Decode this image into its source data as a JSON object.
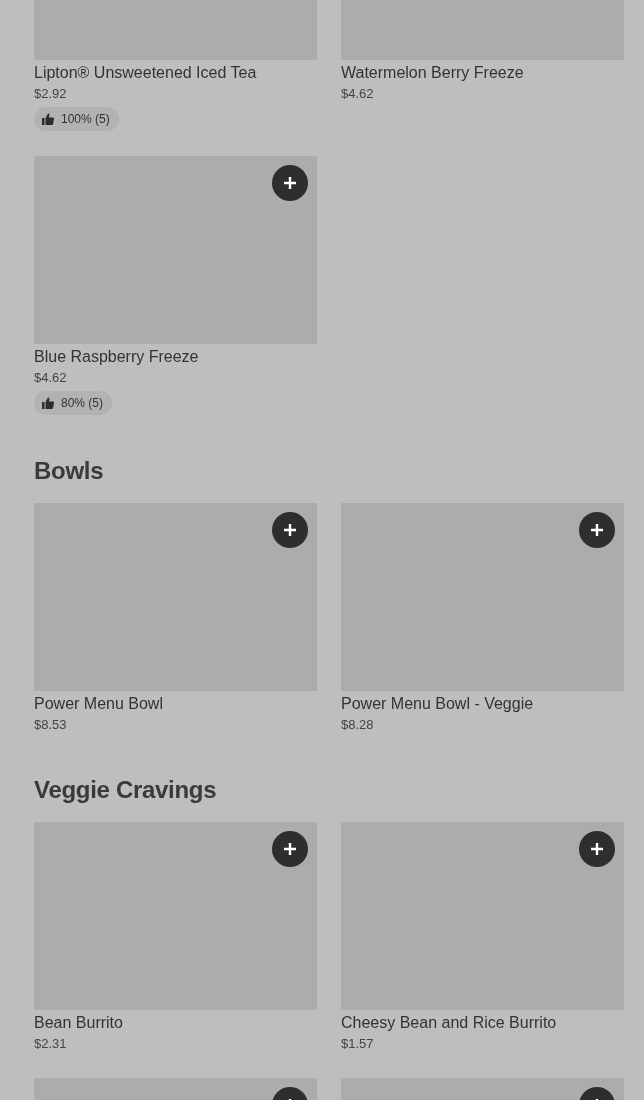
{
  "sections": [
    {
      "items": [
        {
          "kind": "cut",
          "name": "Lipton® Unsweetened Iced Tea",
          "price": "$2.92",
          "rating": "100% (5)"
        },
        {
          "kind": "cut",
          "name": "Watermelon Berry Freeze",
          "price": "$4.62"
        },
        {
          "kind": "full",
          "name": "Blue Raspberry Freeze",
          "price": "$4.62",
          "rating": "80% (5)"
        }
      ]
    },
    {
      "title": "Bowls",
      "items": [
        {
          "kind": "full",
          "name": "Power Menu Bowl",
          "price": "$8.53"
        },
        {
          "kind": "full",
          "name": "Power Menu Bowl - Veggie",
          "price": "$8.28"
        }
      ]
    },
    {
      "title": "Veggie Cravings",
      "items": [
        {
          "kind": "full",
          "name": "Bean Burrito",
          "price": "$2.31"
        },
        {
          "kind": "full",
          "name": "Cheesy Bean and Rice Burrito",
          "price": "$1.57"
        },
        {
          "kind": "full"
        },
        {
          "kind": "full"
        }
      ]
    }
  ]
}
